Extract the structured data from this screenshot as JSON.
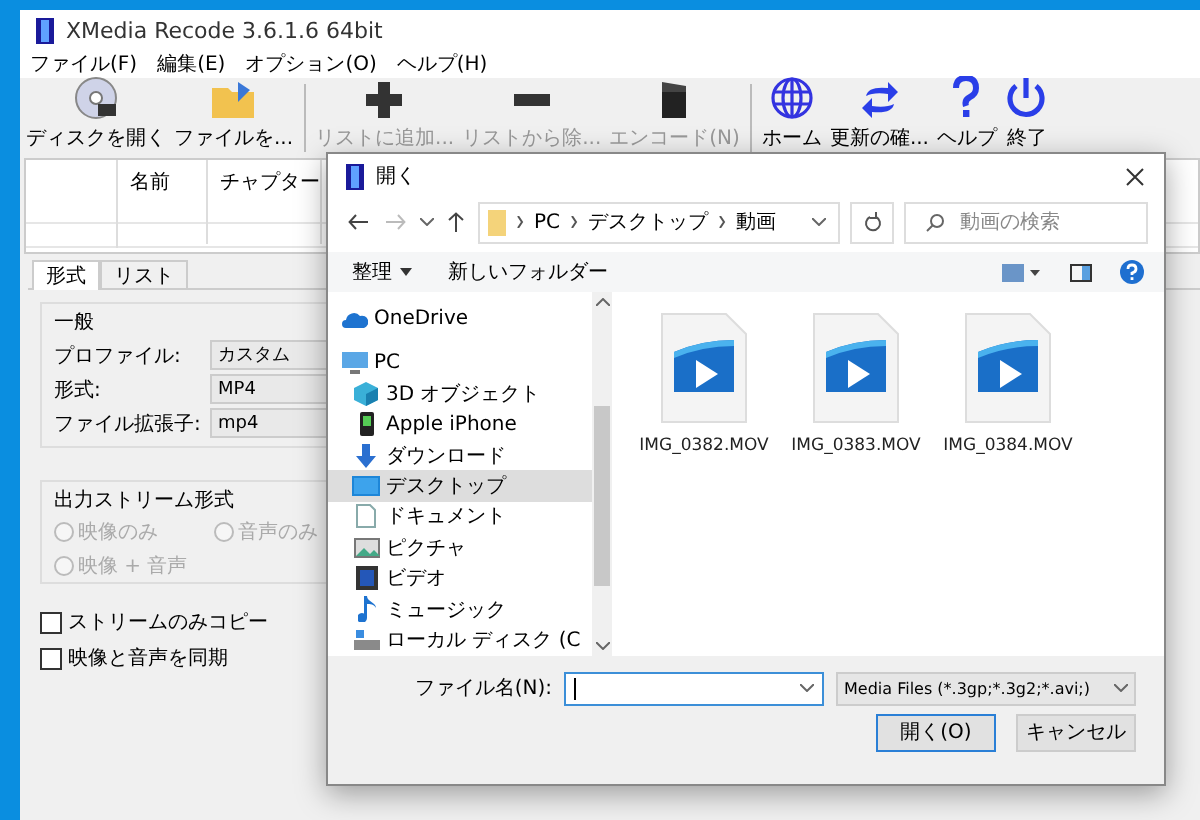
{
  "window": {
    "title": "XMedia Recode 3.6.1.6 64bit"
  },
  "menu": [
    "ファイル(F)",
    "編集(E)",
    "オプション(O)",
    "ヘルプ(H)"
  ],
  "toolbar": [
    {
      "label": "ディスクを開く",
      "disabled": false,
      "separator_before": false
    },
    {
      "label": "ファイルを...",
      "disabled": false,
      "separator_before": false
    },
    {
      "label": "リストに追加...",
      "disabled": true,
      "separator_before": true
    },
    {
      "label": "リストから除...",
      "disabled": true,
      "separator_before": false
    },
    {
      "label": "エンコード(N)",
      "disabled": true,
      "separator_before": false
    },
    {
      "label": "ホーム",
      "disabled": false,
      "separator_before": true
    },
    {
      "label": "更新の確...",
      "disabled": false,
      "separator_before": false
    },
    {
      "label": "ヘルプ",
      "disabled": false,
      "separator_before": false
    },
    {
      "label": "終了",
      "disabled": false,
      "separator_before": false
    }
  ],
  "list": {
    "columns": [
      "名前",
      "チャプター"
    ]
  },
  "tabs": [
    {
      "label": "形式",
      "selected": true
    },
    {
      "label": "リスト",
      "selected": false
    }
  ],
  "general": {
    "title": "一般",
    "fields": [
      {
        "label": "プロファイル:",
        "value": "カスタム"
      },
      {
        "label": "形式:",
        "value": "MP4"
      },
      {
        "label": "ファイル拡張子:",
        "value": "mp4"
      }
    ]
  },
  "output_stream": {
    "title": "出力ストリーム形式",
    "options": [
      {
        "label": "映像のみ",
        "selected": false,
        "disabled": true
      },
      {
        "label": "音声のみ",
        "selected": false,
        "disabled": true
      },
      {
        "label": "映像 + 音声",
        "selected": false,
        "disabled": true
      }
    ]
  },
  "checkboxes": [
    {
      "label": "ストリームのみコピー",
      "checked": false
    },
    {
      "label": "映像と音声を同期",
      "checked": false
    }
  ],
  "dialog": {
    "title": "開く",
    "path": [
      "PC",
      "デスクトップ",
      "動画"
    ],
    "search": {
      "placeholder": "動画の検索"
    },
    "commands": [
      {
        "label": "整理",
        "dropdown": true
      },
      {
        "label": "新しいフォルダー",
        "dropdown": false
      }
    ],
    "nav": [
      {
        "label": "OneDrive",
        "selected": false
      },
      {
        "label": "PC",
        "selected": false,
        "children": [
          {
            "label": "3D オブジェクト",
            "selected": false
          },
          {
            "label": "Apple iPhone",
            "selected": false
          },
          {
            "label": "ダウンロード",
            "selected": false
          },
          {
            "label": "デスクトップ",
            "selected": true
          },
          {
            "label": "ドキュメント",
            "selected": false
          },
          {
            "label": "ピクチャ",
            "selected": false
          },
          {
            "label": "ビデオ",
            "selected": false
          },
          {
            "label": "ミュージック",
            "selected": false
          },
          {
            "label": "ローカル ディスク (C",
            "selected": false
          }
        ]
      }
    ],
    "files": [
      {
        "name": "IMG_0382.MOV"
      },
      {
        "name": "IMG_0383.MOV"
      },
      {
        "name": "IMG_0384.MOV"
      }
    ],
    "filename": {
      "label": "ファイル名(N):"
    },
    "filter": {
      "value": "Media Files (*.3gp;*.3g2;*.avi;)"
    },
    "buttons": [
      {
        "label": "開く(O)",
        "default": true
      },
      {
        "label": "キャンセル",
        "default": false
      }
    ]
  }
}
